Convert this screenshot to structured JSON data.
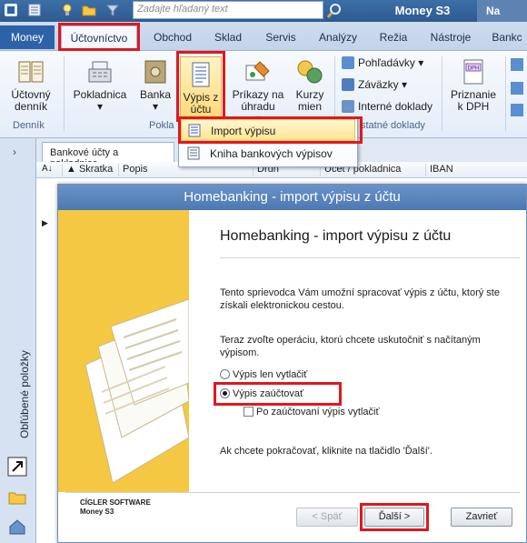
{
  "titlebar": {
    "search_placeholder": "Zadajte hľadaný text",
    "app_title": "Money S3",
    "right_label": "Na"
  },
  "tabs": {
    "money": "Money",
    "items": [
      "Účtovníctvo",
      "Obchod",
      "Sklad",
      "Servis",
      "Analýzy",
      "Režia",
      "Nástroje",
      "Bankc"
    ]
  },
  "ribbon": {
    "ucty": {
      "line1": "Účtovný",
      "line2": "denník",
      "group": "Denník"
    },
    "pokladnica": {
      "line1": "Pokladnica",
      "arrow": "▾"
    },
    "banka": {
      "line1": "Banka",
      "arrow": "▾"
    },
    "vypisy": {
      "line1": "Výpis z",
      "line2": "účtu",
      "arrow": "▾"
    },
    "prikazy": {
      "line1": "Príkazy na",
      "line2": "úhradu",
      "arrow": "▾"
    },
    "kurzy": {
      "line1": "Kurzy",
      "line2": "mien"
    },
    "group_pokladna": "Pokla",
    "pohladavky": "Pohľadávky",
    "zavazky": "Záväzky",
    "interne": "Interné doklady",
    "group_ostatne": "statné doklady",
    "priznanie": {
      "line1": "Priznanie",
      "line2": "k DPH",
      "badge": "DPH"
    }
  },
  "dropdown": {
    "import": "Import výpisu",
    "kniha": "Kniha bankových výpisov"
  },
  "sidebar": {
    "chevron": "›",
    "label": "Obľúbené položky"
  },
  "grid": {
    "doc_tab": "Bankové účty a pokladnice",
    "sort": "A↓",
    "columns": [
      "Skratka",
      "Popis",
      "Druh",
      "Účet / pokladnica",
      "IBAN"
    ],
    "row_marker": "▶"
  },
  "wizard": {
    "window_title": "Homebanking - import výpisu z účtu",
    "heading": "Homebanking - import výpisu z účtu",
    "intro": "Tento sprievodca Vám umožní spracovať výpis z účtu, ktorý ste získali elektronickou cestou.",
    "choose": "Teraz zvoľte operáciu, ktorú chcete uskutočniť s načítaným výpisom.",
    "option_print": "Výpis len vytlačiť",
    "option_post": "Výpis zaúčtovať",
    "checkbox_print_after": "Po zaúčtovaní výpis vytlačiť",
    "continue": "Ak chcete pokračovať, kliknite na tlačidlo 'Ďalší'.",
    "vendor_line1": "CÍGLER SOFTWARE",
    "vendor_line2": "Money S3",
    "back": "< Späť",
    "next": "Ďalší >",
    "close": "Zavrieť"
  },
  "colors": {
    "highlight": "#e0171f",
    "accent": "#2d62a8",
    "wizard_art": "#f4c842"
  }
}
